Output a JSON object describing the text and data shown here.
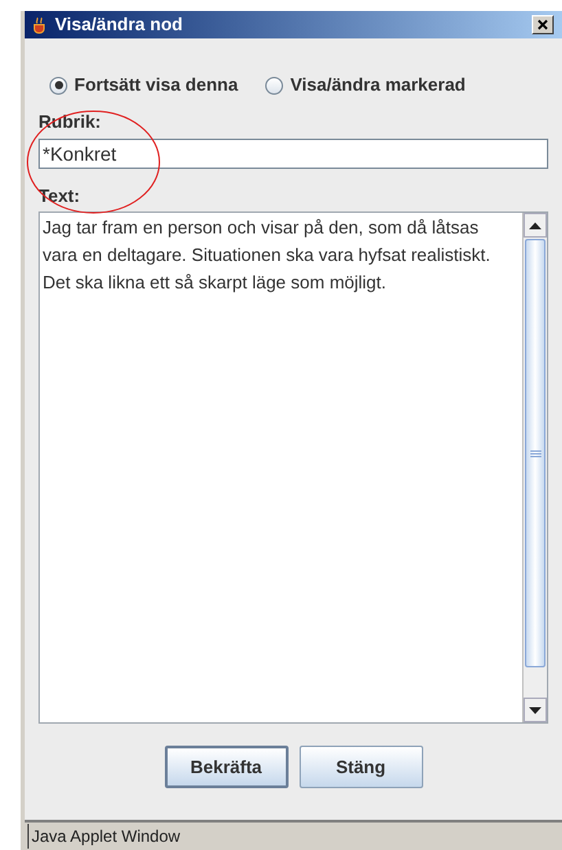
{
  "window": {
    "title": "Visa/ändra nod"
  },
  "radios": [
    {
      "label": "Fortsätt visa denna",
      "selected": true
    },
    {
      "label": "Visa/ändra markerad",
      "selected": false
    }
  ],
  "heading_field": {
    "label": "Rubrik:",
    "value": "*Konkret"
  },
  "text_field": {
    "label": "Text:",
    "value": "Jag tar fram en person och visar på den, som då låtsas vara en deltagare. Situationen ska vara hyfsat realistiskt. Det ska likna ett så skarpt läge som möjligt."
  },
  "buttons": [
    {
      "label": "Bekräfta",
      "focused": true
    },
    {
      "label": "Stäng",
      "focused": false
    }
  ],
  "status_bar": "Java Applet Window"
}
